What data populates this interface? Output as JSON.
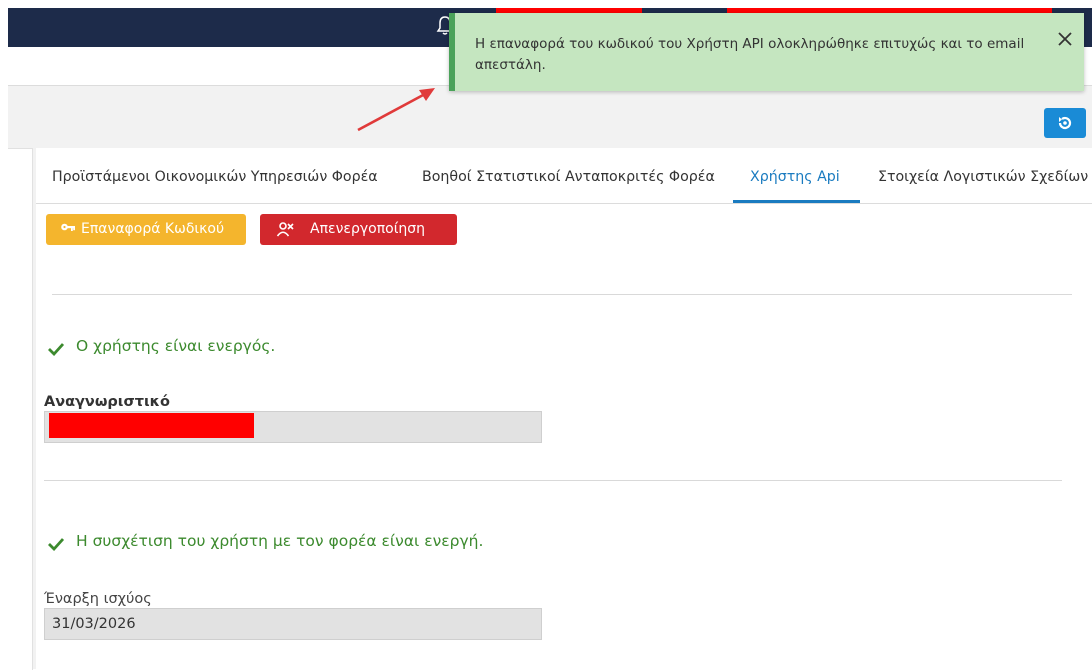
{
  "toast": {
    "message": "Η επαναφορά του κωδικού του Χρήστη API ολοκληρώθηκε επιτυχώς και το email απεστάλη.",
    "close_icon": "close-icon"
  },
  "tabs": [
    {
      "label": "Προϊστάμενοι Οικονομικών Υπηρεσιών Φορέα",
      "active": false
    },
    {
      "label": "Βοηθοί Στατιστικοί Ανταποκριτές Φορέα",
      "active": false
    },
    {
      "label": "Χρήστης Api",
      "active": true
    },
    {
      "label": "Στοιχεία Λογιστικών Σχεδίων",
      "active": false
    }
  ],
  "actions": {
    "reset_password_label": "Επαναφορά Κωδικού",
    "deactivate_label": "Απενεργοποίηση"
  },
  "status": {
    "user_active": "Ο χρήστης είναι ενεργός.",
    "association_active": "Η συσχέτιση του χρήστη με τον φορέα είναι ενεργή."
  },
  "fields": {
    "identifier_label": "Αναγνωριστικό",
    "identifier_value": "",
    "start_date_label": "Έναρξη ισχύος",
    "start_date_value": "31/03/2026"
  },
  "colors": {
    "topbar": "#1d2b4a",
    "accent": "#1a7bc0",
    "warning": "#f4b52d",
    "danger": "#d2282d",
    "success_text": "#3c8a2e",
    "toast_bg": "#c5e6c0",
    "toast_border": "#4ba25a",
    "redaction": "#ff0000"
  }
}
